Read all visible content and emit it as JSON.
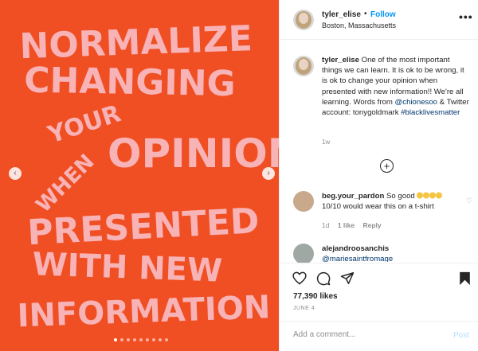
{
  "header": {
    "username": "tyler_elise",
    "separator": "•",
    "follow_label": "Follow",
    "location": "Boston, Massachusetts",
    "more_icon": "more-dots-icon"
  },
  "image_text": [
    "NORMALIZE",
    "CHANGING",
    "YOUR",
    "OPINION",
    "WHEN",
    "PRESENTED",
    "WITH NEW",
    "INFORMATION"
  ],
  "caption": {
    "username": "tyler_elise",
    "text": " One of the most important things we can learn. It is ok to be wrong, it is ok to change your opinion when presented with new information!! We're all learning. Words from ",
    "mention": "@chionesoo",
    "text2": " & Twitter account: tonygoldmark ",
    "hashtag": "#blacklivesmatter",
    "time": "1w"
  },
  "comments": [
    {
      "username": "beg.your_pardon",
      "text": " So good ",
      "text2": " 10/10 would wear this on a t-shirt",
      "emoji_icon": "raising-hands-emoji-icon",
      "time": "1d",
      "likes": "1 like",
      "reply_label": "Reply"
    },
    {
      "username": "alejandroosanchis",
      "text": "@mariesaintfromage"
    }
  ],
  "likes": "77,390 likes",
  "date": "JUNE 4",
  "comment_box": {
    "placeholder": "Add a comment...",
    "post_label": "Post"
  },
  "carousel": {
    "slide_count": 9,
    "active_index": 0
  },
  "colors": {
    "image_bg": "#f04e23",
    "image_text": "#f7b3b6",
    "link": "#00376b",
    "follow": "#0095f6"
  }
}
